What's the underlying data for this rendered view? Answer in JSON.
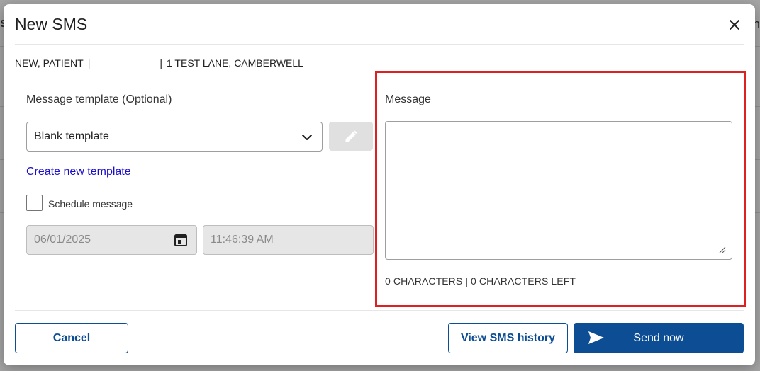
{
  "background": {
    "left_text": "s",
    "right_text": "n"
  },
  "modal": {
    "title": "New SMS",
    "close_icon": "close-icon"
  },
  "patient": {
    "name": "NEW, PATIENT",
    "separator": "|",
    "address": "1 TEST LANE, CAMBERWELL"
  },
  "template": {
    "label": "Message template (Optional)",
    "selected": "Blank template",
    "create_link": "Create new template"
  },
  "schedule": {
    "checkbox_label": "Schedule message",
    "checked": false,
    "date": "06/01/2025",
    "time": "11:46:39 AM"
  },
  "message": {
    "label": "Message",
    "value": "",
    "char_count": "0 CHARACTERS | 0 CHARACTERS LEFT"
  },
  "footer": {
    "cancel_label": "Cancel",
    "history_label": "View SMS history",
    "send_label": "Send now"
  },
  "colors": {
    "primary": "#0d4d94",
    "highlight": "#e02020",
    "link": "#1a0dcc"
  }
}
